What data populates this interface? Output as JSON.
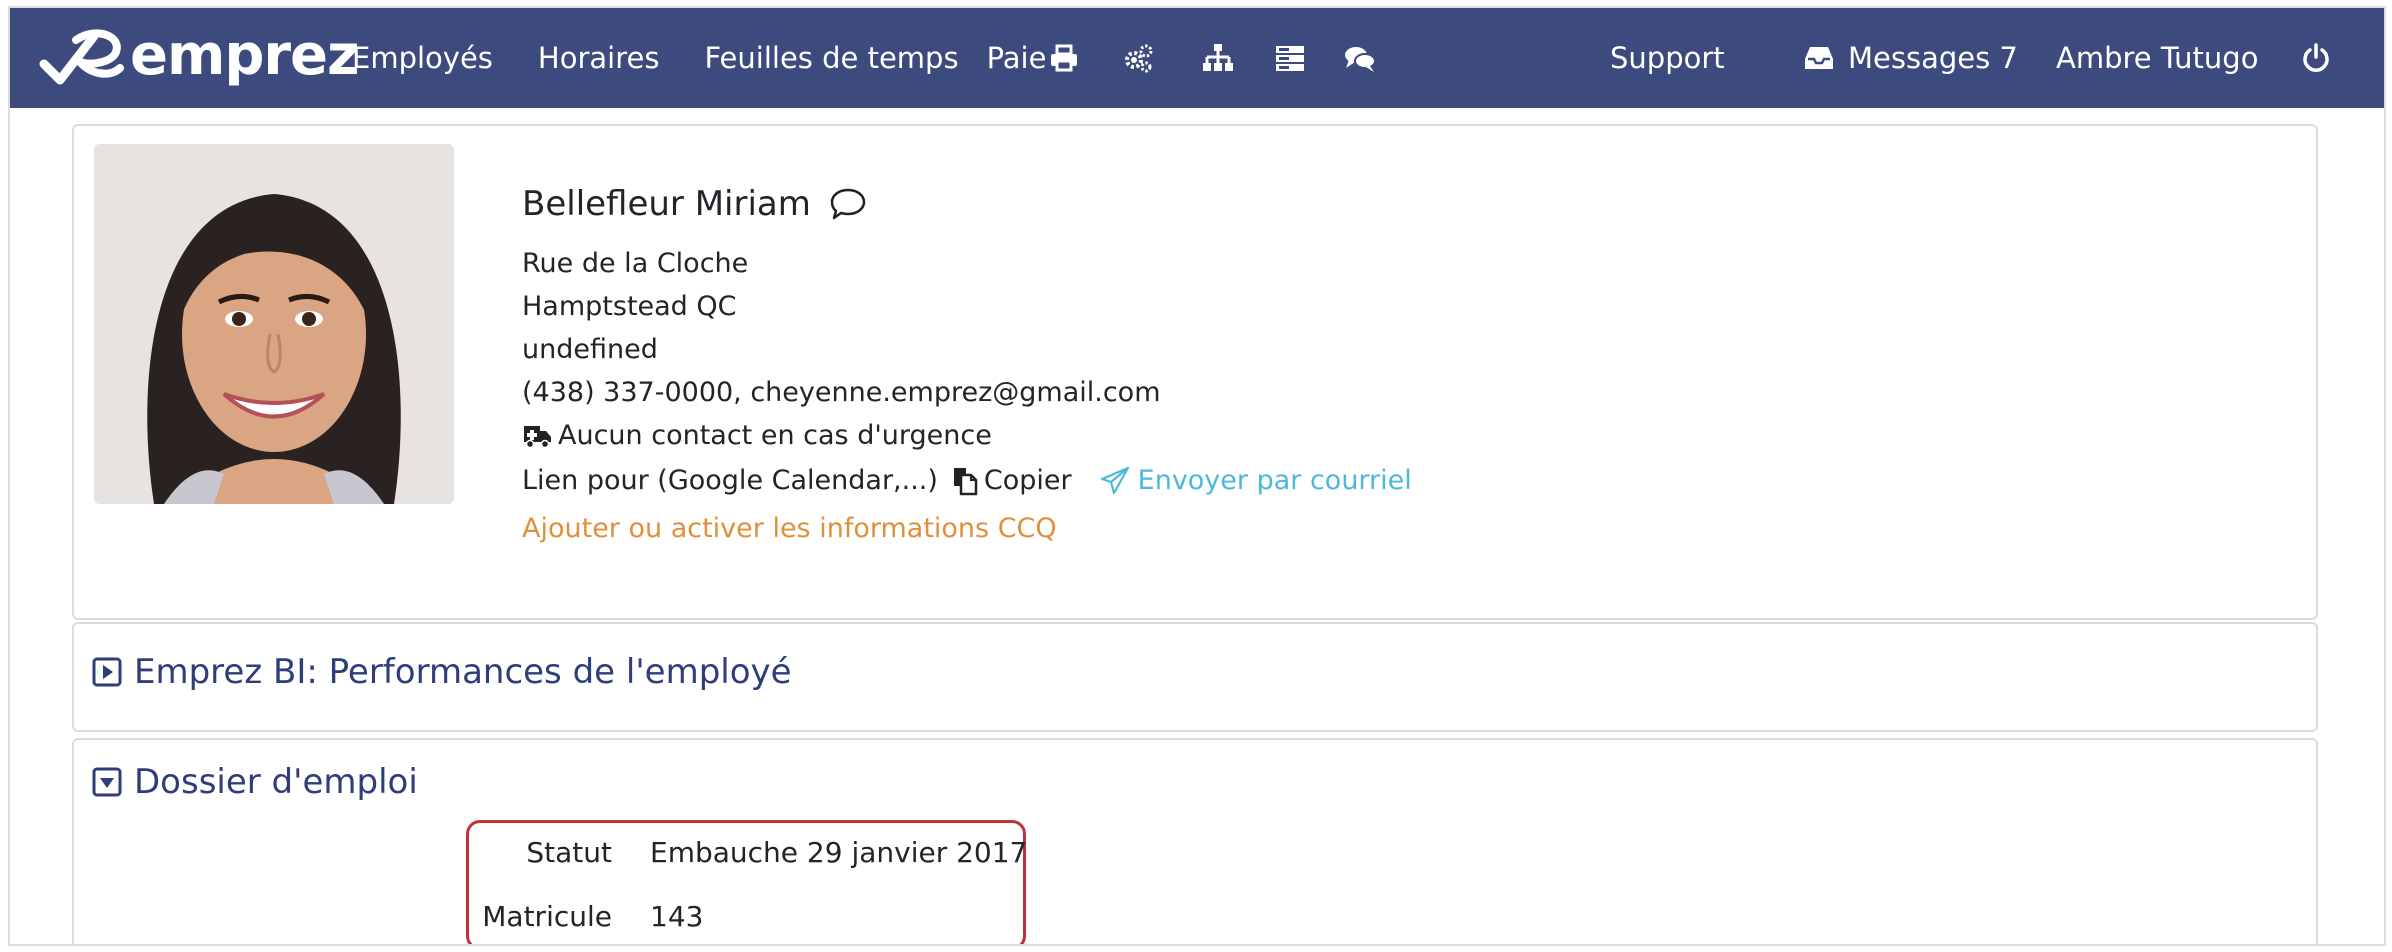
{
  "nav": {
    "brand": "emprez",
    "links": [
      "Employés",
      "Horaires",
      "Feuilles de temps",
      "Paie"
    ],
    "icons": [
      "print-icon",
      "cogs-icon",
      "sitemap-icon",
      "server-icon",
      "comments-icon"
    ],
    "support": "Support",
    "messages_label": "Messages 7",
    "user": "Ambre Tutugo",
    "colors": {
      "bar": "#3c4a7e",
      "text": "#ffffff"
    }
  },
  "profile": {
    "name": "Bellefleur Miriam",
    "address_line1": "Rue de la Cloche",
    "address_line2": "Hamptstead QC",
    "address_line3": "undefined",
    "contact": "(438) 337-0000, cheyenne.emprez@gmail.com",
    "emergency": "Aucun contact en cas d'urgence",
    "calendar_link_label": "Lien pour (Google Calendar,...)",
    "copy_label": "Copier",
    "send_email_label": "Envoyer par courriel",
    "ccq_label": "Ajouter ou activer les informations CCQ",
    "colors": {
      "send": "#4cb9dc",
      "ccq": "#e0903a"
    }
  },
  "sections": {
    "bi_title": "Emprez BI: Performances de l'employé",
    "dossier_title": "Dossier d'emploi",
    "title_color": "#2d3e7a"
  },
  "dossier": {
    "fields": [
      {
        "label": "Statut",
        "value": "Embauche 29 janvier 2017"
      },
      {
        "label": "Matricule",
        "value": "143"
      }
    ],
    "highlight_color": "#c0323a"
  }
}
